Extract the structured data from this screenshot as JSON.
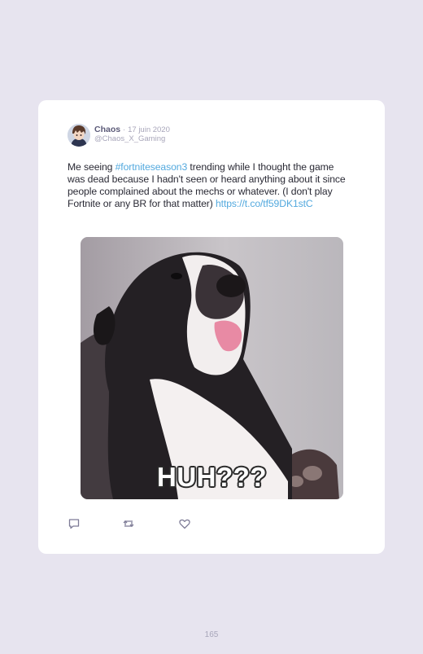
{
  "tweet": {
    "author_name": "Chaos",
    "separator": "·",
    "date": "17 juin 2020",
    "handle": "@Chaos_X_Gaming",
    "text_before": "Me seeing ",
    "hashtag": "#fortniteseason3",
    "text_after": " trending while I thought the game was dead because I hadn't seen or heard anything about it since people complained about the mechs or whatever. (I don't play Fortnite or any BR for that matter) ",
    "link": "https://t.co/tf59DK1stC",
    "media": {
      "caption": "HUH???"
    },
    "actions": [
      {
        "name": "reply",
        "icon": "comment-icon"
      },
      {
        "name": "retweet",
        "icon": "retweet-icon"
      },
      {
        "name": "like",
        "icon": "heart-icon"
      }
    ]
  },
  "page": {
    "number": "165"
  },
  "colors": {
    "background": "#e7e4ef",
    "card": "#ffffff",
    "link": "#53a9de",
    "muted": "#a8a6ba",
    "author": "#5b5a78",
    "icon": "#7d7b96"
  }
}
